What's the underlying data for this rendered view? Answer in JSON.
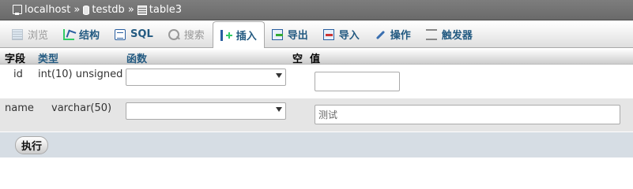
{
  "breadcrumb": {
    "server": "localhost",
    "database": "testdb",
    "table": "table3",
    "separator": "»"
  },
  "tabs": [
    {
      "label": "浏览",
      "icon": "browse-icon",
      "state": "disabled"
    },
    {
      "label": "结构",
      "icon": "structure-icon",
      "state": "normal"
    },
    {
      "label": "SQL",
      "icon": "sql-icon",
      "state": "normal"
    },
    {
      "label": "搜索",
      "icon": "search-icon",
      "state": "disabled"
    },
    {
      "label": "插入",
      "icon": "insert-icon",
      "state": "active"
    },
    {
      "label": "导出",
      "icon": "export-icon",
      "state": "normal"
    },
    {
      "label": "导入",
      "icon": "import-icon",
      "state": "normal"
    },
    {
      "label": "操作",
      "icon": "operations-icon",
      "state": "normal"
    },
    {
      "label": "触发器",
      "icon": "triggers-icon",
      "state": "normal"
    }
  ],
  "table_header": {
    "field": "字段",
    "type": "类型",
    "function": "函数",
    "null": "空",
    "value": "值"
  },
  "rows": [
    {
      "field": "id",
      "type": "int(10) unsigned",
      "function": "",
      "value": ""
    },
    {
      "field": "name",
      "type": "varchar(50)",
      "function": "",
      "value": "测试"
    }
  ],
  "actions": {
    "go_label": "执行"
  },
  "colors": {
    "link": "#235a81",
    "breadcrumb_bg": "#737373",
    "footer_bg": "#d6dde4"
  }
}
